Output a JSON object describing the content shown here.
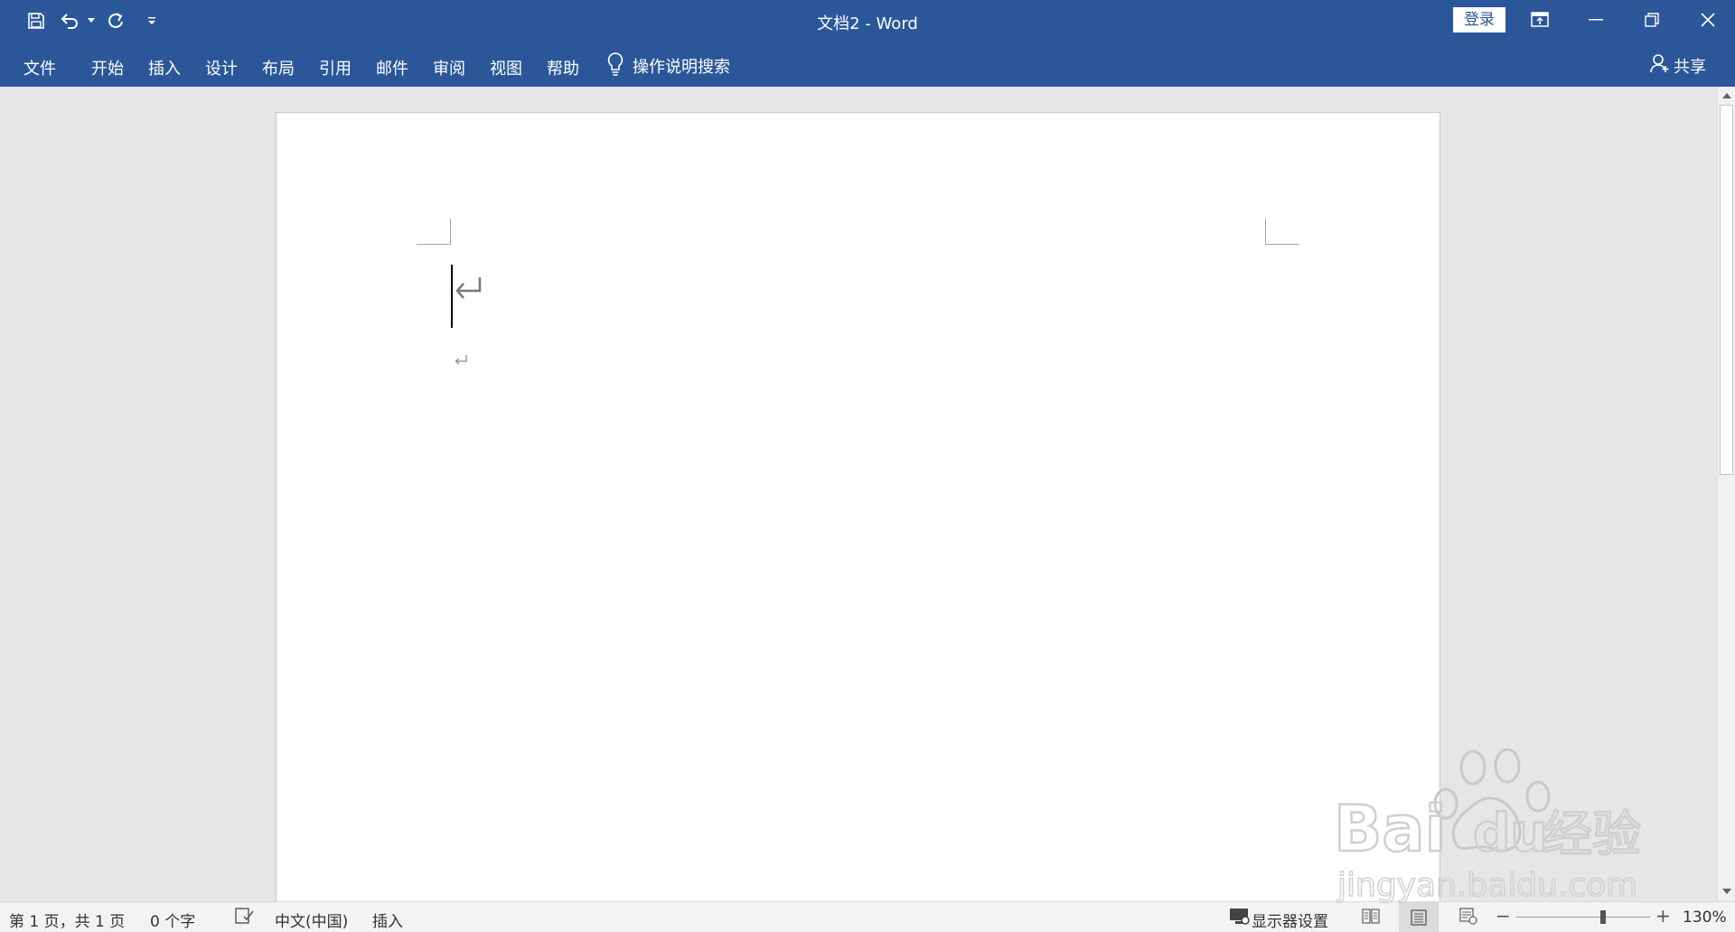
{
  "window": {
    "title": "文档2  -  Word"
  },
  "title_bar": {
    "signin_label": "登录"
  },
  "quick_access": {
    "icons": [
      "save-icon",
      "undo-icon",
      "dropdown-arrow-icon",
      "redo-icon",
      "customize-icon"
    ]
  },
  "window_controls": [
    "ribbon-display-icon",
    "minimize-icon",
    "restore-icon",
    "close-icon"
  ],
  "ribbon": {
    "tabs": [
      "文件",
      "开始",
      "插入",
      "设计",
      "布局",
      "引用",
      "邮件",
      "审阅",
      "视图",
      "帮助"
    ],
    "tell_me": "操作说明搜索",
    "share": "共享"
  },
  "status_bar": {
    "page_info": "第 1 页，共 1 页",
    "word_count": "0 个字",
    "language": "中文(中国)",
    "mode": "插入",
    "display_settings": "显示器设置",
    "zoom_level": "130%",
    "zoom_fraction": 0.3
  },
  "watermark": {
    "line1": "Bai 经验",
    "line2": "jingyan.baidu.com"
  },
  "colors": {
    "accent": "#2b579a",
    "page": "#ffffff",
    "canvas": "#e6e6e6"
  }
}
